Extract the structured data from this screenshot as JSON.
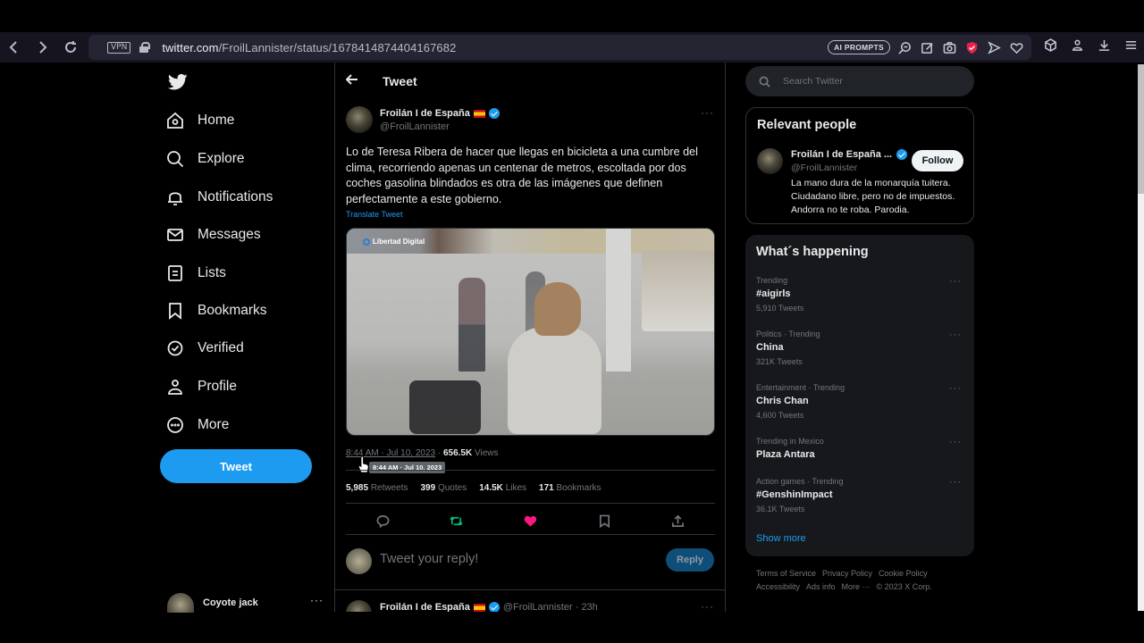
{
  "browser": {
    "url_host": "twitter.com",
    "url_path": "/FroilLannister/status/1678414874404167682",
    "vpn_label": "VPN",
    "ai_prompts_label": "AI PROMPTS"
  },
  "nav": {
    "items": [
      {
        "label": "Home",
        "icon": "home-icon"
      },
      {
        "label": "Explore",
        "icon": "search-icon"
      },
      {
        "label": "Notifications",
        "icon": "bell-icon"
      },
      {
        "label": "Messages",
        "icon": "envelope-icon"
      },
      {
        "label": "Lists",
        "icon": "list-icon"
      },
      {
        "label": "Bookmarks",
        "icon": "bookmark-icon"
      },
      {
        "label": "Verified",
        "icon": "verified-icon"
      },
      {
        "label": "Profile",
        "icon": "person-icon"
      },
      {
        "label": "More",
        "icon": "more-circle-icon"
      }
    ],
    "tweet_button": "Tweet",
    "account_name": "Coyote jack",
    "account_more": "···"
  },
  "header": {
    "title": "Tweet"
  },
  "tweet": {
    "author_name": "Froilán I de España",
    "author_handle": "@FroilLannister",
    "more": "···",
    "text": "Lo de Teresa Ribera de hacer que llegas en bicicleta a una cumbre del clima, recorriendo apenas un centenar de metros, escoltada por dos coches gasolina blindados es otra de las imágenes que definen perfectamente a este gobierno.",
    "translate": "Translate Tweet",
    "media_watermark": "Libertad Digital",
    "timestamp": "8:44 AM · Jul 10, 2023",
    "views_count": "656.5K",
    "views_label": "Views",
    "tooltip": "8:44 AM · Jul 10, 2023",
    "stats": [
      {
        "count": "5,985",
        "label": "Retweets"
      },
      {
        "count": "399",
        "label": "Quotes"
      },
      {
        "count": "14.5K",
        "label": "Likes"
      },
      {
        "count": "171",
        "label": "Bookmarks"
      }
    ],
    "liked": true,
    "retweeted": true,
    "colors": {
      "like": "#f91880",
      "retweet": "#00ba7c"
    }
  },
  "reply": {
    "placeholder": "Tweet your reply!",
    "button": "Reply"
  },
  "next_tweet": {
    "author_name": "Froilán I de España",
    "handle_time": "@FroilLannister · 23h",
    "more": "···"
  },
  "sidebar": {
    "search_placeholder": "Search Twitter",
    "relevant_people": {
      "title": "Relevant people",
      "name": "Froilán I de España ...",
      "handle": "@FroilLannister",
      "follow": "Follow",
      "bio": "La mano dura de la monarquía tuitera. Ciudadano libre, pero no de impuestos. Andorra no te roba. Parodia."
    },
    "whats_happening": {
      "title": "What´s happening",
      "trends": [
        {
          "context": "Trending",
          "name": "#aigirls",
          "count": "5,910 Tweets"
        },
        {
          "context": "Politics · Trending",
          "name": "China",
          "count": "321K Tweets"
        },
        {
          "context": "Entertainment · Trending",
          "name": "Chris Chan",
          "count": "4,600 Tweets"
        },
        {
          "context": "Trending in Mexico",
          "name": "Plaza Antara",
          "count": ""
        },
        {
          "context": "Action games · Trending",
          "name": "#GenshinImpact",
          "count": "36.1K Tweets"
        }
      ],
      "more_label": "···",
      "show_more": "Show more"
    },
    "footer": [
      "Terms of Service",
      "Privacy Policy",
      "Cookie Policy",
      "Accessibility",
      "Ads info",
      "More ···",
      "© 2023 X Corp."
    ]
  },
  "colors": {
    "accent": "#1d9bf0",
    "background": "#000000",
    "card": "#16181c",
    "border": "#2f3336"
  }
}
